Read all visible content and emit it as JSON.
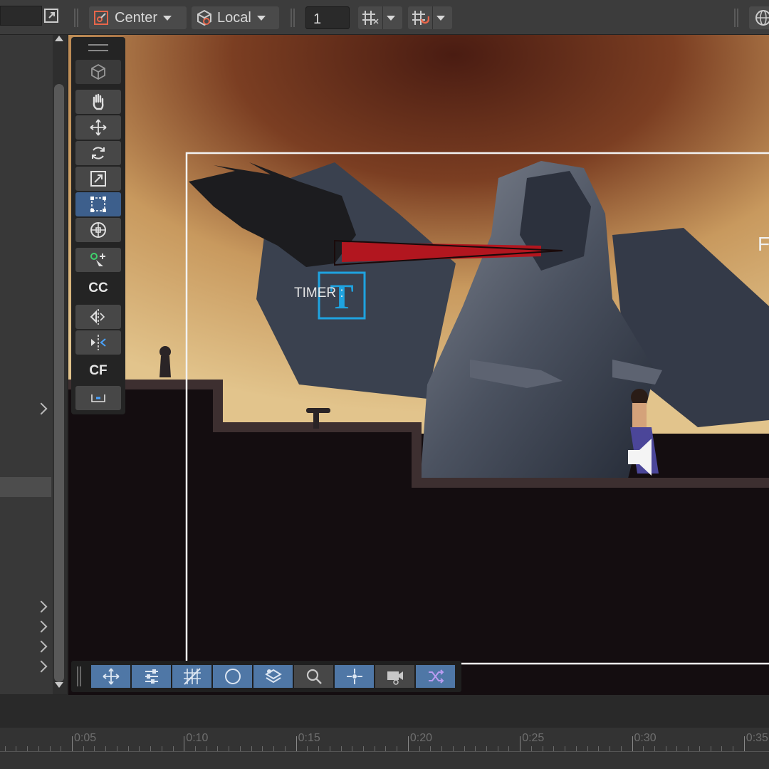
{
  "toolbar": {
    "pivot_label": "Center",
    "space_label": "Local",
    "increment_value": "1"
  },
  "scene": {
    "timer_label": "TIMER :",
    "right_label": "F",
    "sky_color": "#d6b27a",
    "ground_color": "#140d10"
  },
  "tools_overlay": {
    "cc_label": "CC",
    "cf_label": "CF"
  },
  "timeline": {
    "ticks": [
      "0:05",
      "0:10",
      "0:15",
      "0:20",
      "0:25",
      "0:30",
      "0:35"
    ]
  }
}
